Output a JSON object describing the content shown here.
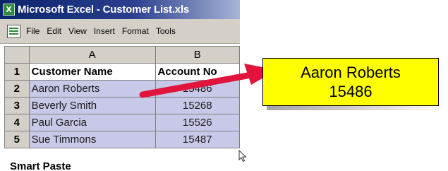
{
  "window": {
    "title": "Microsoft Excel - Customer List.xls",
    "app_icon_glyph": "X"
  },
  "menubar": {
    "items": [
      "File",
      "Edit",
      "View",
      "Insert",
      "Format",
      "Tools"
    ]
  },
  "sheet": {
    "columns": [
      "A",
      "B"
    ],
    "rows": [
      {
        "num": "1",
        "name": "Customer Name",
        "account": "Account No"
      },
      {
        "num": "2",
        "name": "Aaron Roberts",
        "account": "15486"
      },
      {
        "num": "3",
        "name": "Beverly Smith",
        "account": "15268"
      },
      {
        "num": "4",
        "name": "Paul Garcia",
        "account": "15526"
      },
      {
        "num": "5",
        "name": "Sue Timmons",
        "account": "15487"
      }
    ]
  },
  "callout": {
    "line1": "Aaron Roberts",
    "line2": "15486"
  },
  "caption": "Smart Paste",
  "colors": {
    "titlebar": "#0a246a",
    "selection": "#c8c8e8",
    "callout_fill": "#ffff00",
    "arrow": "#e0143c",
    "chrome": "#d4d0c8"
  },
  "icons": {
    "app": "excel-app-icon",
    "document": "workbook-doc-icon",
    "pointer": "mouse-pointer-icon",
    "arrow": "red-arrow-icon"
  }
}
